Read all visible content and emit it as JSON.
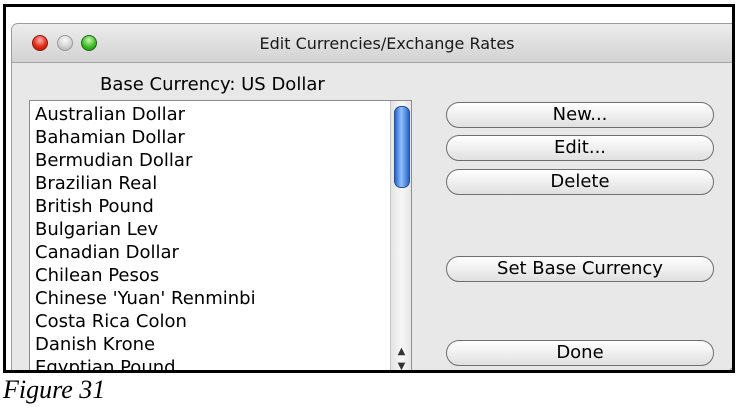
{
  "window": {
    "title": "Edit Currencies/Exchange Rates"
  },
  "base_currency_label": "Base Currency: US Dollar",
  "currencies": [
    "Australian Dollar",
    "Bahamian Dollar",
    "Bermudian Dollar",
    "Brazilian Real",
    "British Pound",
    "Bulgarian Lev",
    "Canadian Dollar",
    "Chilean Pesos",
    "Chinese 'Yuan' Renminbi",
    "Costa Rica Colon",
    "Danish Krone",
    "Egyptian Pound"
  ],
  "buttons": {
    "new": "New...",
    "edit": "Edit...",
    "delete": "Delete",
    "set_base": "Set Base Currency",
    "done": "Done"
  },
  "caption": "Figure 31",
  "colors": {
    "close": "#e22a17",
    "minimize": "#cfcfcf",
    "zoom": "#3fbf28",
    "scroll_thumb": "#2a64c8"
  }
}
